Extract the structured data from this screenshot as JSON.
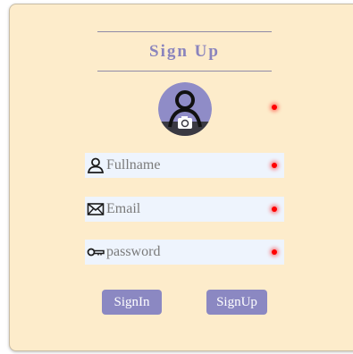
{
  "header": {
    "title": "Sign Up"
  },
  "avatar": {
    "icon": "user-camera-icon"
  },
  "fields": {
    "fullname": {
      "placeholder": "Fullname",
      "value": "",
      "icon": "user-icon"
    },
    "email": {
      "placeholder": "Email",
      "value": "",
      "icon": "envelope-icon"
    },
    "password": {
      "placeholder": "password",
      "value": "",
      "icon": "key-icon"
    }
  },
  "buttons": {
    "signin_label": "SignIn",
    "signup_label": "SignUp"
  },
  "colors": {
    "card_background": "#fdeccb",
    "accent": "#8b88c2",
    "field_background": "#eef4fd",
    "indicator": "#ff0000"
  }
}
